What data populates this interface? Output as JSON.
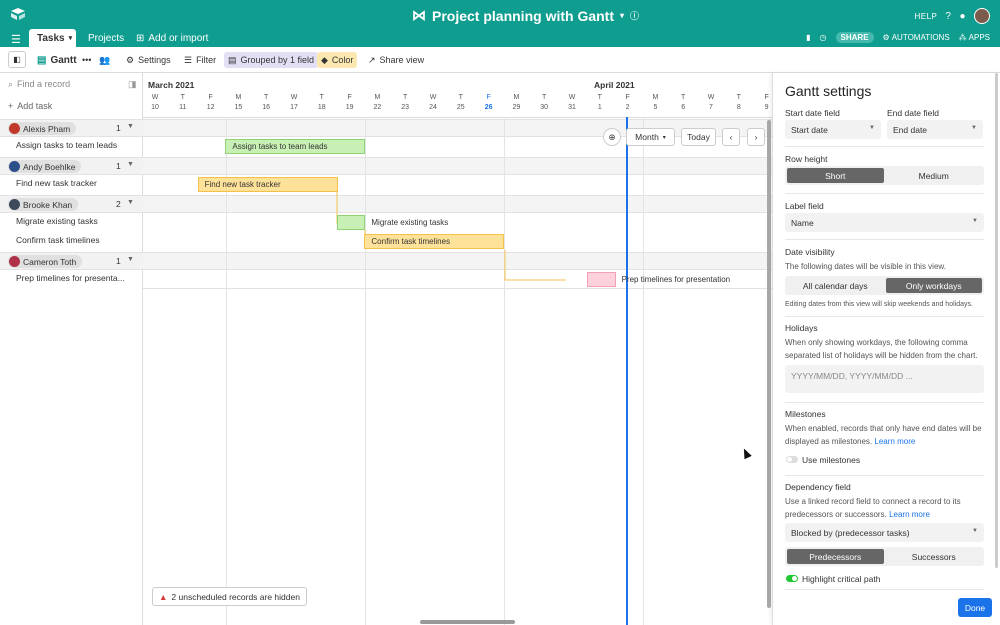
{
  "app": {
    "base_title": "Project planning with Gantt",
    "help_label": "HELP",
    "share_label": "SHARE",
    "automations_label": "AUTOMATIONS",
    "apps_label": "APPS"
  },
  "tabs": [
    {
      "label": "Tasks",
      "active": true
    },
    {
      "label": "Projects",
      "active": false
    },
    {
      "label": "Add or import",
      "active": false
    }
  ],
  "toolbar": {
    "view_name": "Gantt",
    "settings_label": "Settings",
    "filter_label": "Filter",
    "grouped_label": "Grouped by 1 field",
    "color_label": "Color",
    "share_view_label": "Share view",
    "grouped_bg": "#e3e0f5",
    "color_bg": "#fbe7b0"
  },
  "left_pane": {
    "find_placeholder": "Find a record",
    "add_task_label": "Add task",
    "groups": [
      {
        "name": "Alexis Pham",
        "count": "1",
        "face_color": "#c0392b",
        "tasks": [
          "Assign tasks to team leads"
        ]
      },
      {
        "name": "Andy Boehlke",
        "count": "1",
        "face_color": "#2c4f8a",
        "tasks": [
          "Find new task tracker"
        ]
      },
      {
        "name": "Brooke Khan",
        "count": "2",
        "face_color": "#3d4a5c",
        "tasks": [
          "Migrate existing tasks",
          "Confirm task timelines"
        ]
      },
      {
        "name": "Cameron Toth",
        "count": "1",
        "face_color": "#b0324a",
        "tasks": [
          "Prep timelines for presenta..."
        ]
      }
    ]
  },
  "timeline": {
    "months": [
      "March 2021",
      "April 2021"
    ],
    "days": [
      {
        "d": "W",
        "n": "10"
      },
      {
        "d": "T",
        "n": "11"
      },
      {
        "d": "F",
        "n": "12"
      },
      {
        "d": "M",
        "n": "15"
      },
      {
        "d": "T",
        "n": "16"
      },
      {
        "d": "W",
        "n": "17"
      },
      {
        "d": "T",
        "n": "18"
      },
      {
        "d": "F",
        "n": "19"
      },
      {
        "d": "M",
        "n": "22"
      },
      {
        "d": "T",
        "n": "23"
      },
      {
        "d": "W",
        "n": "24"
      },
      {
        "d": "T",
        "n": "25"
      },
      {
        "d": "F",
        "n": "26",
        "today": true
      },
      {
        "d": "M",
        "n": "29"
      },
      {
        "d": "T",
        "n": "30"
      },
      {
        "d": "W",
        "n": "31"
      },
      {
        "d": "T",
        "n": "1"
      },
      {
        "d": "F",
        "n": "2"
      },
      {
        "d": "M",
        "n": "5"
      },
      {
        "d": "T",
        "n": "6"
      },
      {
        "d": "W",
        "n": "7"
      },
      {
        "d": "T",
        "n": "8"
      },
      {
        "d": "F",
        "n": "9"
      }
    ],
    "month_select": "Month",
    "today_label": "Today",
    "tasks": [
      {
        "label": "Assign tasks to team leads",
        "color": "green",
        "start": "Mar 15",
        "end": "Mar 19",
        "label_inside": true
      },
      {
        "label": "Find new task tracker",
        "color": "yellow",
        "start": "Mar 12",
        "end": "Mar 18",
        "label_inside": true
      },
      {
        "label": "Migrate existing tasks",
        "color": "green",
        "start": "Mar 19",
        "end": "Mar 19",
        "label_inside": false
      },
      {
        "label": "Confirm task timelines",
        "color": "yellow",
        "start": "Mar 22",
        "end": "Mar 26",
        "label_inside": true
      },
      {
        "label": "Prep timelines for presentation",
        "color": "pink",
        "start": "Apr 1",
        "end": "Apr 1",
        "label_inside": false
      }
    ],
    "unscheduled_label": "2 unscheduled records are hidden"
  },
  "settings": {
    "title": "Gantt settings",
    "start_date_field_label": "Start date field",
    "start_date_field_value": "Start date",
    "end_date_field_label": "End date field",
    "end_date_field_value": "End date",
    "row_height_label": "Row height",
    "row_height_options": [
      "Short",
      "Medium"
    ],
    "label_field_label": "Label field",
    "label_field_value": "Name",
    "date_visibility_label": "Date visibility",
    "date_visibility_desc": "The following dates will be visible in this view.",
    "date_visibility_options": [
      "All calendar days",
      "Only workdays"
    ],
    "date_visibility_note": "Editing dates from this view will skip weekends and holidays.",
    "holidays_label": "Holidays",
    "holidays_desc": "When only showing workdays, the following comma separated list of holidays will be hidden from the chart.",
    "holidays_placeholder": "YYYY/MM/DD, YYYY/MM/DD ...",
    "milestones_label": "Milestones",
    "milestones_desc": "When enabled, records that only have end dates will be displayed as milestones.",
    "learn_more": "Learn more",
    "use_milestones_label": "Use milestones",
    "dependency_field_label": "Dependency field",
    "dependency_desc": "Use a linked record field to connect a record to its predecessors or successors.",
    "dependency_value": "Blocked by (predecessor tasks)",
    "dependency_options": [
      "Predecessors",
      "Successors"
    ],
    "highlight_label": "Highlight critical path",
    "done_label": "Done"
  }
}
